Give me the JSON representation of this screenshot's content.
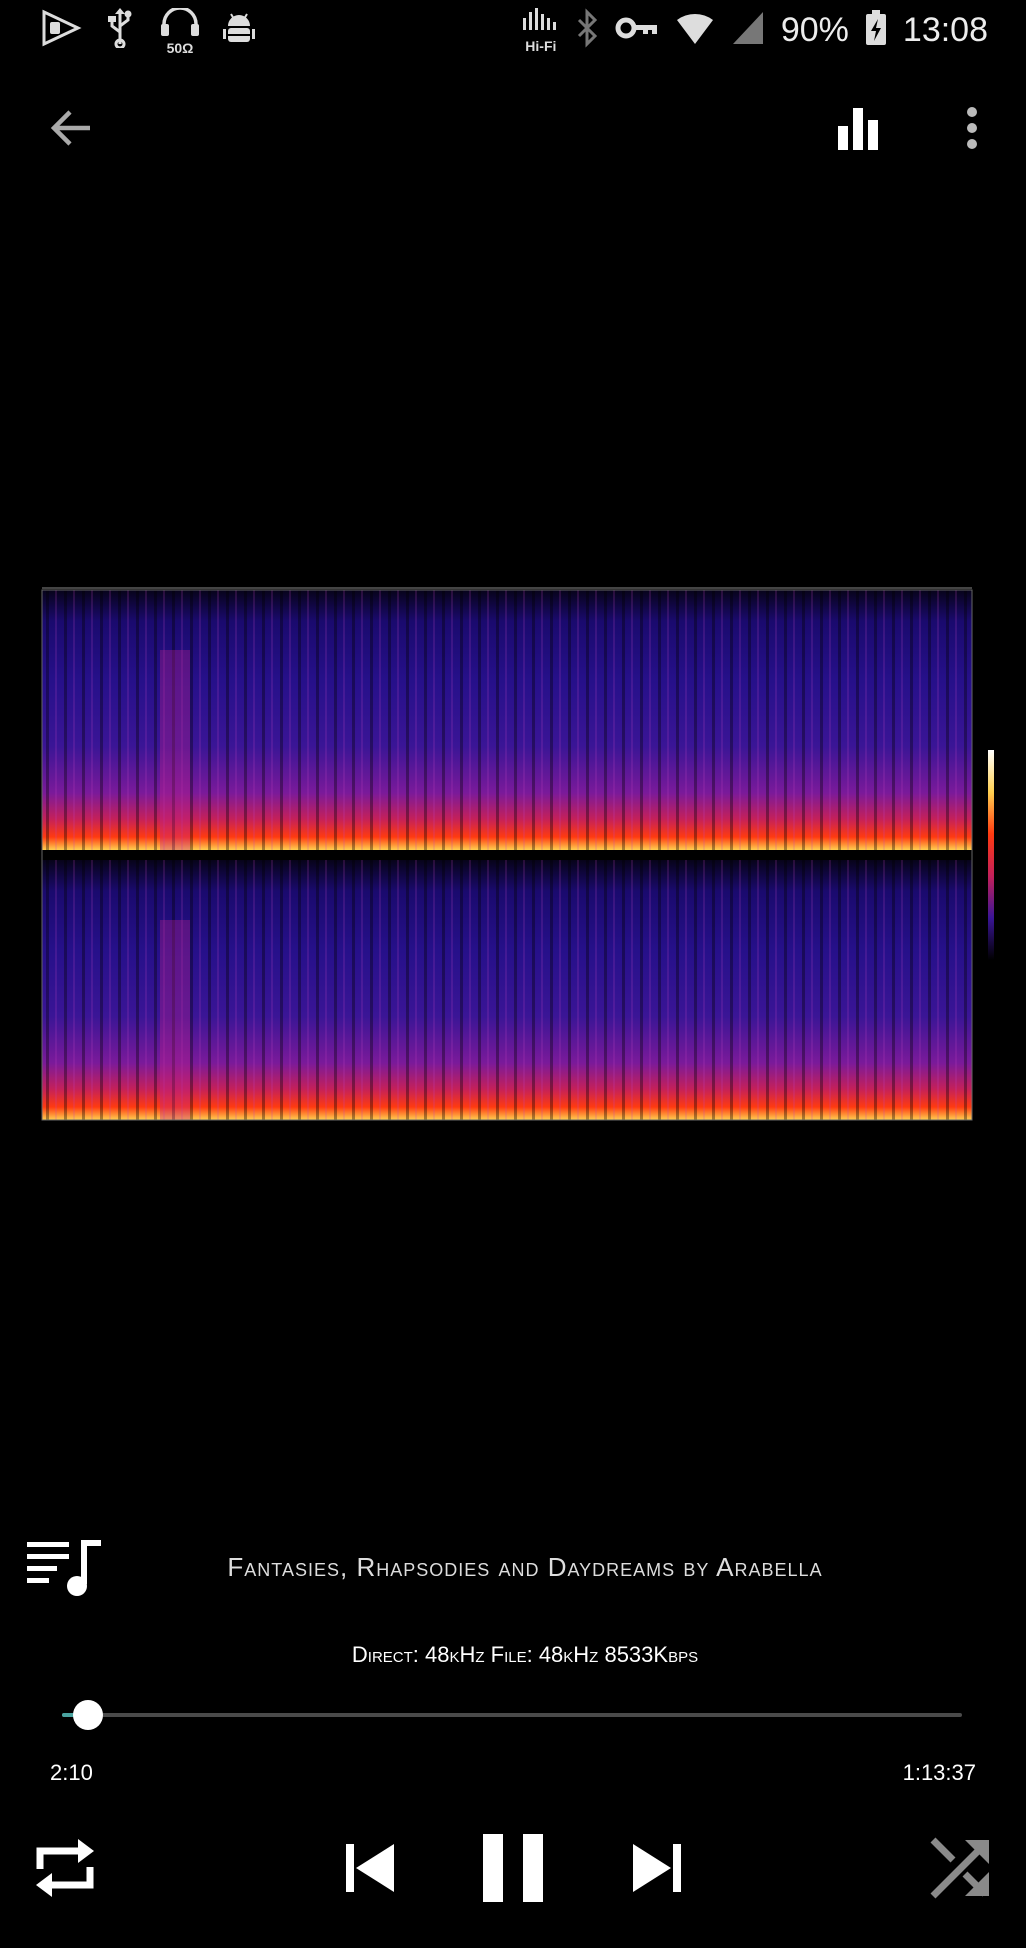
{
  "status_bar": {
    "headphone_impedance": "50Ω",
    "hifi_label": "Hi-Fi",
    "battery_percent": "90%",
    "clock": "13:08",
    "icons": [
      "play-store-icon",
      "usb-icon",
      "headphones-icon",
      "android-debug-icon",
      "hifi-icon",
      "bluetooth-icon",
      "vpn-key-icon",
      "wifi-icon",
      "cell-signal-icon",
      "battery-charging-icon"
    ]
  },
  "toolbar": {
    "icons": [
      "back-arrow-icon",
      "equalizer-icon",
      "more-vert-icon"
    ]
  },
  "now_playing": {
    "title": "Fantasies, Rhapsodies and Daydreams by Arabella",
    "audio_info": "Direct: 48kHz  File: 48kHz  8533Kbps",
    "elapsed": "2:10",
    "duration": "1:13:37",
    "progress_fraction": 0.029
  },
  "controls": {
    "icons": [
      "queue-music-icon",
      "repeat-icon",
      "skip-previous-icon",
      "pause-icon",
      "skip-next-icon",
      "shuffle-icon"
    ]
  },
  "colors": {
    "background": "#000000",
    "progress_fill": "#4aa3a0",
    "progress_track": "#4a4a4a",
    "icon": "#ffffff",
    "shuffle_inactive": "#8a8a8a"
  }
}
